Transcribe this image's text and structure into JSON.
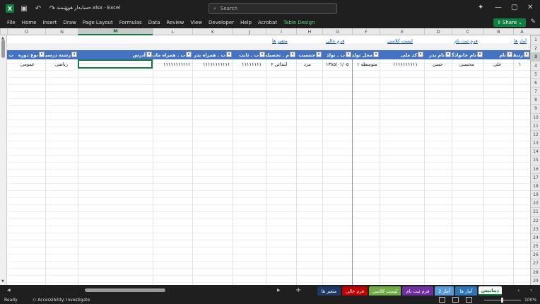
{
  "window": {
    "doc_title": "حسابدار هوشمند.xlsx  ·  Excel",
    "search_placeholder": "Search"
  },
  "ribbon": {
    "tabs": [
      "File",
      "Home",
      "Insert",
      "Draw",
      "Page Layout",
      "Formulas",
      "Data",
      "Review",
      "View",
      "Developer",
      "Help",
      "Acrobat",
      "Table Design"
    ],
    "share_label": "Share"
  },
  "columns": [
    "O",
    "N",
    "M",
    "L",
    "K",
    "J",
    "I",
    "H",
    "G",
    "F",
    "E",
    "D",
    "C",
    "B",
    "A"
  ],
  "selected_column": "M",
  "rows": [
    "1",
    "2",
    "3",
    "4",
    "5",
    "6",
    "7",
    "8",
    "9",
    "10",
    "11",
    "12",
    "13",
    "14",
    "15",
    "16",
    "17",
    "18",
    "19",
    "20",
    "21",
    "22",
    "23",
    "24",
    "25",
    "26",
    "27",
    "28",
    "29"
  ],
  "selected_row": "3",
  "links": {
    "stats": "آمار ها",
    "reg_form": "فرم ثبت نام",
    "class_list": "لیست کلاسی",
    "blank_form": "فرم خالی",
    "variables": "متغیر ها"
  },
  "table_headers": {
    "row": "ردیف",
    "name": "نام",
    "family": "نام خانوادگی",
    "father": "نام پدر",
    "national_code": "کد ملی",
    "birth_place": "محل تولد",
    "birth_date": "ت . تولد",
    "gender": "جنسیت",
    "education": "م . تحصیلی",
    "landline": "ت . ثابت",
    "father_phone": "ت . همراه پدر",
    "mother_phone": "ت . همراه مادر",
    "address": "آدرس",
    "field": "رشته درسی",
    "course_type": "نوع دوره",
    "extra": "ت"
  },
  "record": {
    "row": "۱",
    "name": "علی",
    "family": "محسنی",
    "father": "حسن",
    "national_code": "۱۱۱۱۱۱۱۱۱۱",
    "birth_place": "متوسطه ۱",
    "birth_date": "۱۳۸۵/۰۱/۰۵",
    "gender": "مرد",
    "education": "ابتدائی ۶",
    "landline": "۱۱۱۱۱۱۱۱",
    "father_phone": "۱۱۱۱۱۱۱۱۱۱۱",
    "mother_phone": "۱۱۱۱۱۱۱۱۱۱۱",
    "address": "",
    "field": "ریاضی",
    "course_type": "عمومی"
  },
  "sheet_tabs": [
    {
      "label": "دیتابیس",
      "color": "#f5f5f5",
      "active": true
    },
    {
      "label": "آمار ها",
      "color": "#2e75b6",
      "active": false
    },
    {
      "label": "آمار 2",
      "color": "#5b9bd5",
      "active": false
    },
    {
      "label": "فرم ثبت نام",
      "color": "#7030a0",
      "active": false
    },
    {
      "label": "لیست کلاسی",
      "color": "#70ad47",
      "active": false
    },
    {
      "label": "فرم خالی",
      "color": "#c00000",
      "active": false
    },
    {
      "label": "متغیر ها",
      "color": "#1f3864",
      "active": false
    }
  ],
  "status": {
    "ready": "Ready",
    "accessibility": "Accessibility: Investigate",
    "zoom": "100%"
  },
  "colors": {
    "accent": "#107c41",
    "table_header": "#4472c4",
    "link": "#1155cc"
  }
}
